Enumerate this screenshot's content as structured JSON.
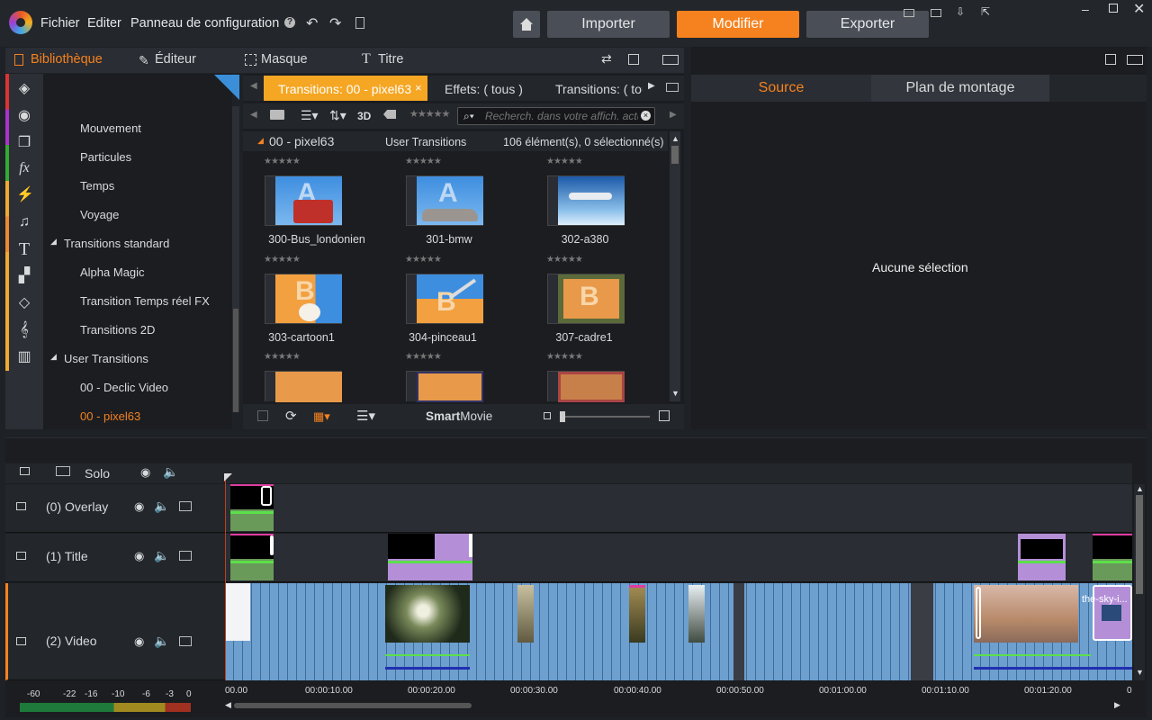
{
  "menu": {
    "file": "Fichier",
    "edit": "Editer",
    "control_panel": "Panneau de configuration"
  },
  "modes": {
    "import": "Importer",
    "edit": "Modifier",
    "export": "Exporter"
  },
  "library_tabs": {
    "library": "Bibliothèque",
    "editor": "Éditeur",
    "mask": "Masque",
    "title": "Titre"
  },
  "tree": {
    "items": [
      "Mouvement",
      "Particules",
      "Temps",
      "Voyage"
    ],
    "group_standard": "Transitions standard",
    "standard_items": [
      "Alpha Magic",
      "Transition Temps réel FX",
      "Transitions 2D"
    ],
    "group_user": "User Transitions",
    "user_items": [
      "00 - Declic Video",
      "00 - pixel63"
    ]
  },
  "lib_tabs": {
    "tab1": "Transitions: 00 - pixel63",
    "tab2": "Effets: ( tous )",
    "tab3": "Transitions: ( tou"
  },
  "search": {
    "placeholder": "Recherch. dans votre affich. actu"
  },
  "toolbar": {
    "threed": "3D"
  },
  "collection": {
    "name": "00 - pixel63",
    "group": "User Transitions",
    "count": "106 élément(s), 0 sélectionné(s)"
  },
  "thumbs": [
    {
      "label": "300-Bus_londonien"
    },
    {
      "label": "301-bmw"
    },
    {
      "label": "302-a380"
    },
    {
      "label": "303-cartoon1"
    },
    {
      "label": "304-pinceau1"
    },
    {
      "label": "307-cadre1"
    }
  ],
  "smartmovie": {
    "bold": "Smart",
    "normal": "Movie"
  },
  "right_tabs": {
    "source": "Source",
    "timeline": "Plan de montage"
  },
  "preview": {
    "empty": "Aucune sélection"
  },
  "tracks": {
    "solo": "Solo",
    "overlay": "(0) Overlay",
    "title": "(1) Title",
    "video": "(2) Video"
  },
  "ruler": [
    "00.00",
    "00:00:10.00",
    "00:00:20.00",
    "00:00:30.00",
    "00:00:40.00",
    "00:00:50.00",
    "00:01:00.00",
    "00:01:10.00",
    "00:01:20.00",
    "0"
  ],
  "meter": [
    "-60",
    "-22",
    "-16",
    "-10",
    "-6",
    "-3",
    "0"
  ],
  "clip_label": "the-sky-i...",
  "colors": {
    "accent": "#f5821f",
    "tab_active": "#f5821f",
    "video_clip": "#6d9fcf",
    "title_clip": "#b48fd8"
  }
}
